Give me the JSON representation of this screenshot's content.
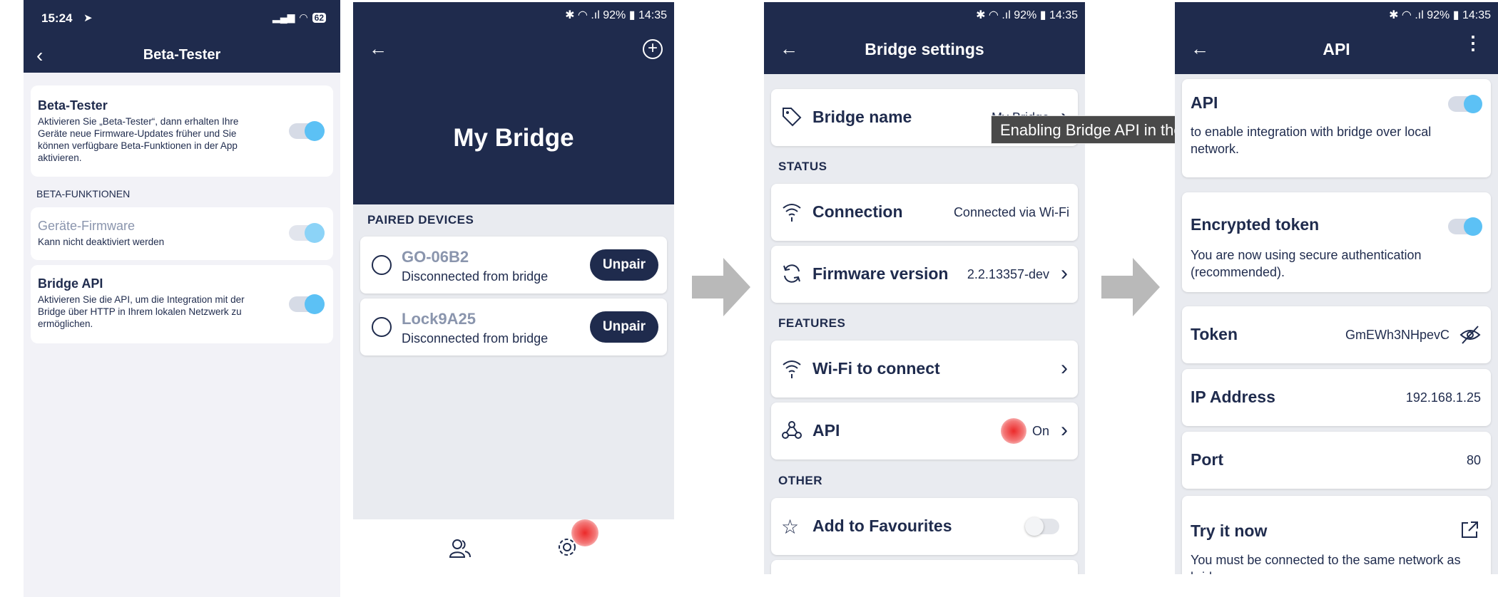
{
  "screen1": {
    "status_time": "15:24",
    "battery": "62",
    "title": "Beta-Tester",
    "beta_tester": {
      "title": "Beta-Tester",
      "description": "Aktivieren Sie „Beta-Tester“, dann erhalten Ihre Geräte neue Firmware-Updates früher und Sie können verfügbare Beta-Funktionen in der App aktivieren.",
      "enabled": true
    },
    "section_label": "BETA-FUNKTIONEN",
    "firmware": {
      "title": "Geräte-Firmware",
      "description": "Kann nicht deaktiviert werden",
      "enabled": true
    },
    "bridge_api": {
      "title": "Bridge API",
      "description": "Aktivieren Sie die API, um die Integration mit der Bridge über HTTP in Ihrem lokalen Netzwerk zu ermöglichen.",
      "enabled": true
    }
  },
  "screen2": {
    "status_text": "92%",
    "status_time": "14:35",
    "title": "My Bridge",
    "section_label": "PAIRED DEVICES",
    "devices": [
      {
        "name": "GO-06B2",
        "status": "Disconnected from bridge",
        "action": "Unpair"
      },
      {
        "name": "Lock9A25",
        "status": "Disconnected from bridge",
        "action": "Unpair"
      }
    ]
  },
  "screen3": {
    "status_text": "92%",
    "status_time": "14:35",
    "title": "Bridge settings",
    "bridge_name": {
      "label": "Bridge name",
      "value": "My Bridge"
    },
    "section_status": "STATUS",
    "connection": {
      "label": "Connection",
      "value": "Connected via Wi-Fi"
    },
    "firmware": {
      "label": "Firmware version",
      "value": "2.2.13357-dev"
    },
    "section_features": "FEATURES",
    "wifi": {
      "label": "Wi-Fi to connect"
    },
    "api": {
      "label": "API",
      "value": "On"
    },
    "section_other": "OTHER",
    "favourites": {
      "label": "Add to Favourites",
      "enabled": false
    },
    "tooltip": "Enabling Bridge API in the mobile app"
  },
  "screen4": {
    "status_text": "92%",
    "status_time": "14:35",
    "title": "API",
    "api": {
      "title": "API",
      "description_visible": "to enable integration with bridge over local network.",
      "enabled": true
    },
    "encrypted_token": {
      "title": "Encrypted token",
      "description": "You are now using secure authentication (recommended).",
      "enabled": true
    },
    "token": {
      "label": "Token",
      "value": "GmEWh3NHpevC"
    },
    "ip": {
      "label": "IP Address",
      "value": "192.168.1.25"
    },
    "port": {
      "label": "Port",
      "value": "80"
    },
    "try_it": {
      "label": "Try it now",
      "description": "You must be connected to the same network as bridge"
    }
  },
  "colors": {
    "navy": "#1f2b4d",
    "toggle_on": "#5cc1f5",
    "background": "#e9ebf0",
    "highlight": "#eb1e1e"
  },
  "icons": [
    "back-arrow-icon",
    "plus-circle-icon",
    "users-icon",
    "gear-icon",
    "tag-icon",
    "wifi-icon",
    "refresh-icon",
    "webhook-icon",
    "star-icon",
    "eye-off-icon",
    "external-link-icon",
    "more-vertical-icon",
    "chevron-right-icon",
    "lock-device-icon"
  ]
}
